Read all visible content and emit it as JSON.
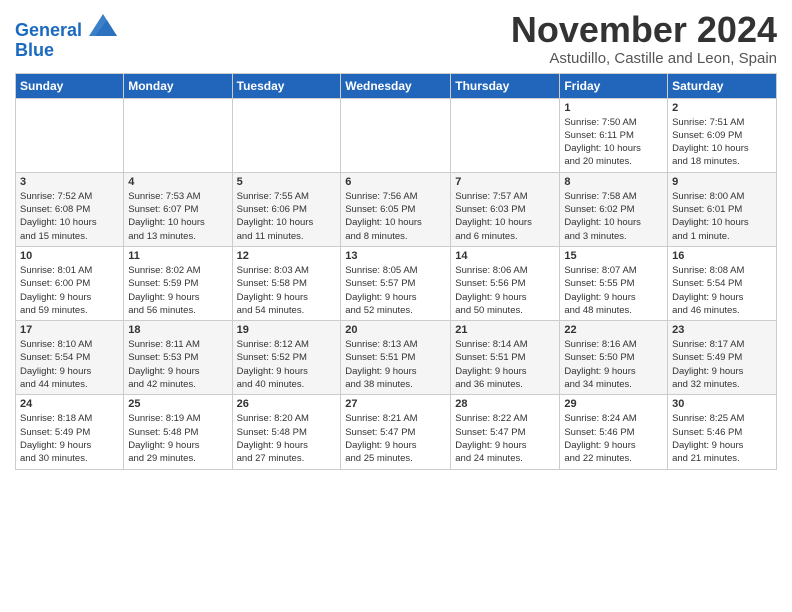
{
  "header": {
    "logo_line1": "General",
    "logo_line2": "Blue",
    "month": "November 2024",
    "location": "Astudillo, Castille and Leon, Spain"
  },
  "weekdays": [
    "Sunday",
    "Monday",
    "Tuesday",
    "Wednesday",
    "Thursday",
    "Friday",
    "Saturday"
  ],
  "weeks": [
    [
      {
        "day": "",
        "info": ""
      },
      {
        "day": "",
        "info": ""
      },
      {
        "day": "",
        "info": ""
      },
      {
        "day": "",
        "info": ""
      },
      {
        "day": "",
        "info": ""
      },
      {
        "day": "1",
        "info": "Sunrise: 7:50 AM\nSunset: 6:11 PM\nDaylight: 10 hours\nand 20 minutes."
      },
      {
        "day": "2",
        "info": "Sunrise: 7:51 AM\nSunset: 6:09 PM\nDaylight: 10 hours\nand 18 minutes."
      }
    ],
    [
      {
        "day": "3",
        "info": "Sunrise: 7:52 AM\nSunset: 6:08 PM\nDaylight: 10 hours\nand 15 minutes."
      },
      {
        "day": "4",
        "info": "Sunrise: 7:53 AM\nSunset: 6:07 PM\nDaylight: 10 hours\nand 13 minutes."
      },
      {
        "day": "5",
        "info": "Sunrise: 7:55 AM\nSunset: 6:06 PM\nDaylight: 10 hours\nand 11 minutes."
      },
      {
        "day": "6",
        "info": "Sunrise: 7:56 AM\nSunset: 6:05 PM\nDaylight: 10 hours\nand 8 minutes."
      },
      {
        "day": "7",
        "info": "Sunrise: 7:57 AM\nSunset: 6:03 PM\nDaylight: 10 hours\nand 6 minutes."
      },
      {
        "day": "8",
        "info": "Sunrise: 7:58 AM\nSunset: 6:02 PM\nDaylight: 10 hours\nand 3 minutes."
      },
      {
        "day": "9",
        "info": "Sunrise: 8:00 AM\nSunset: 6:01 PM\nDaylight: 10 hours\nand 1 minute."
      }
    ],
    [
      {
        "day": "10",
        "info": "Sunrise: 8:01 AM\nSunset: 6:00 PM\nDaylight: 9 hours\nand 59 minutes."
      },
      {
        "day": "11",
        "info": "Sunrise: 8:02 AM\nSunset: 5:59 PM\nDaylight: 9 hours\nand 56 minutes."
      },
      {
        "day": "12",
        "info": "Sunrise: 8:03 AM\nSunset: 5:58 PM\nDaylight: 9 hours\nand 54 minutes."
      },
      {
        "day": "13",
        "info": "Sunrise: 8:05 AM\nSunset: 5:57 PM\nDaylight: 9 hours\nand 52 minutes."
      },
      {
        "day": "14",
        "info": "Sunrise: 8:06 AM\nSunset: 5:56 PM\nDaylight: 9 hours\nand 50 minutes."
      },
      {
        "day": "15",
        "info": "Sunrise: 8:07 AM\nSunset: 5:55 PM\nDaylight: 9 hours\nand 48 minutes."
      },
      {
        "day": "16",
        "info": "Sunrise: 8:08 AM\nSunset: 5:54 PM\nDaylight: 9 hours\nand 46 minutes."
      }
    ],
    [
      {
        "day": "17",
        "info": "Sunrise: 8:10 AM\nSunset: 5:54 PM\nDaylight: 9 hours\nand 44 minutes."
      },
      {
        "day": "18",
        "info": "Sunrise: 8:11 AM\nSunset: 5:53 PM\nDaylight: 9 hours\nand 42 minutes."
      },
      {
        "day": "19",
        "info": "Sunrise: 8:12 AM\nSunset: 5:52 PM\nDaylight: 9 hours\nand 40 minutes."
      },
      {
        "day": "20",
        "info": "Sunrise: 8:13 AM\nSunset: 5:51 PM\nDaylight: 9 hours\nand 38 minutes."
      },
      {
        "day": "21",
        "info": "Sunrise: 8:14 AM\nSunset: 5:51 PM\nDaylight: 9 hours\nand 36 minutes."
      },
      {
        "day": "22",
        "info": "Sunrise: 8:16 AM\nSunset: 5:50 PM\nDaylight: 9 hours\nand 34 minutes."
      },
      {
        "day": "23",
        "info": "Sunrise: 8:17 AM\nSunset: 5:49 PM\nDaylight: 9 hours\nand 32 minutes."
      }
    ],
    [
      {
        "day": "24",
        "info": "Sunrise: 8:18 AM\nSunset: 5:49 PM\nDaylight: 9 hours\nand 30 minutes."
      },
      {
        "day": "25",
        "info": "Sunrise: 8:19 AM\nSunset: 5:48 PM\nDaylight: 9 hours\nand 29 minutes."
      },
      {
        "day": "26",
        "info": "Sunrise: 8:20 AM\nSunset: 5:48 PM\nDaylight: 9 hours\nand 27 minutes."
      },
      {
        "day": "27",
        "info": "Sunrise: 8:21 AM\nSunset: 5:47 PM\nDaylight: 9 hours\nand 25 minutes."
      },
      {
        "day": "28",
        "info": "Sunrise: 8:22 AM\nSunset: 5:47 PM\nDaylight: 9 hours\nand 24 minutes."
      },
      {
        "day": "29",
        "info": "Sunrise: 8:24 AM\nSunset: 5:46 PM\nDaylight: 9 hours\nand 22 minutes."
      },
      {
        "day": "30",
        "info": "Sunrise: 8:25 AM\nSunset: 5:46 PM\nDaylight: 9 hours\nand 21 minutes."
      }
    ]
  ]
}
